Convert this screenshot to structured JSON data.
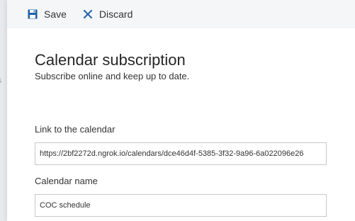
{
  "background": {
    "fragment_text": "s"
  },
  "toolbar": {
    "save_label": "Save",
    "discard_label": "Discard",
    "accent_color": "#1f5fa8"
  },
  "main": {
    "title": "Calendar subscription",
    "subtitle": "Subscribe online and keep up to date."
  },
  "fields": {
    "link_label": "Link to the calendar",
    "link_value": "https://2bf2272d.ngrok.io/calendars/dce46d4f-5385-3f32-9a96-6a022096e26",
    "name_label": "Calendar name",
    "name_value": "COC schedule"
  }
}
